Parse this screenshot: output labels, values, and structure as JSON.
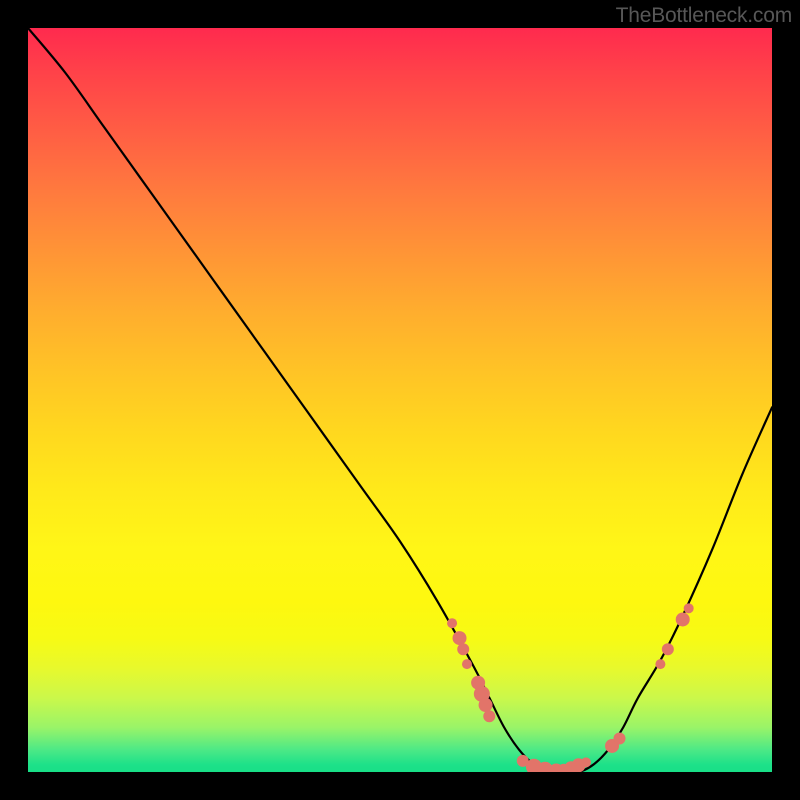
{
  "watermark": "TheBottleneck.com",
  "chart_data": {
    "type": "line",
    "title": "",
    "xlabel": "",
    "ylabel": "",
    "xlim": [
      0,
      100
    ],
    "ylim": [
      0,
      100
    ],
    "grid": false,
    "curve": {
      "comment": "V-shaped bottleneck curve; y is bottleneck severity (0=green/optimal, 100=red/worst). Values estimated from gradient position.",
      "x": [
        0,
        5,
        10,
        15,
        20,
        25,
        30,
        35,
        40,
        45,
        50,
        55,
        60,
        62,
        64,
        66,
        68,
        70,
        72,
        74,
        76,
        78,
        80,
        82,
        85,
        88,
        92,
        96,
        100
      ],
      "y": [
        100,
        94,
        87,
        80,
        73,
        66,
        59,
        52,
        45,
        38,
        31,
        23,
        14,
        10,
        6,
        3,
        1,
        0,
        0,
        0,
        1,
        3,
        6,
        10,
        15,
        21,
        30,
        40,
        49
      ]
    },
    "markers": {
      "comment": "Salmon-colored data points overlaid on the curve (estimated positions).",
      "color": "#e27469",
      "points": [
        {
          "x": 57.0,
          "y": 20.0,
          "r": 5
        },
        {
          "x": 58.0,
          "y": 18.0,
          "r": 7
        },
        {
          "x": 58.5,
          "y": 16.5,
          "r": 6
        },
        {
          "x": 59.0,
          "y": 14.5,
          "r": 5
        },
        {
          "x": 60.5,
          "y": 12.0,
          "r": 7
        },
        {
          "x": 61.0,
          "y": 10.5,
          "r": 8
        },
        {
          "x": 61.5,
          "y": 9.0,
          "r": 7
        },
        {
          "x": 62.0,
          "y": 7.5,
          "r": 6
        },
        {
          "x": 66.5,
          "y": 1.5,
          "r": 6
        },
        {
          "x": 68.0,
          "y": 0.7,
          "r": 8
        },
        {
          "x": 69.5,
          "y": 0.3,
          "r": 8
        },
        {
          "x": 71.0,
          "y": 0.2,
          "r": 7
        },
        {
          "x": 72.0,
          "y": 0.3,
          "r": 6
        },
        {
          "x": 73.0,
          "y": 0.5,
          "r": 7
        },
        {
          "x": 74.0,
          "y": 0.9,
          "r": 7
        },
        {
          "x": 75.0,
          "y": 1.3,
          "r": 5
        },
        {
          "x": 78.5,
          "y": 3.5,
          "r": 7
        },
        {
          "x": 79.5,
          "y": 4.5,
          "r": 6
        },
        {
          "x": 85.0,
          "y": 14.5,
          "r": 5
        },
        {
          "x": 86.0,
          "y": 16.5,
          "r": 6
        },
        {
          "x": 88.0,
          "y": 20.5,
          "r": 7
        },
        {
          "x": 88.8,
          "y": 22.0,
          "r": 5
        }
      ]
    },
    "gradient_stops": [
      {
        "pos": 0.0,
        "color": "#ff2a4e"
      },
      {
        "pos": 0.5,
        "color": "#ffd71f"
      },
      {
        "pos": 0.95,
        "color": "#4de986"
      },
      {
        "pos": 1.0,
        "color": "#18df87"
      }
    ]
  }
}
